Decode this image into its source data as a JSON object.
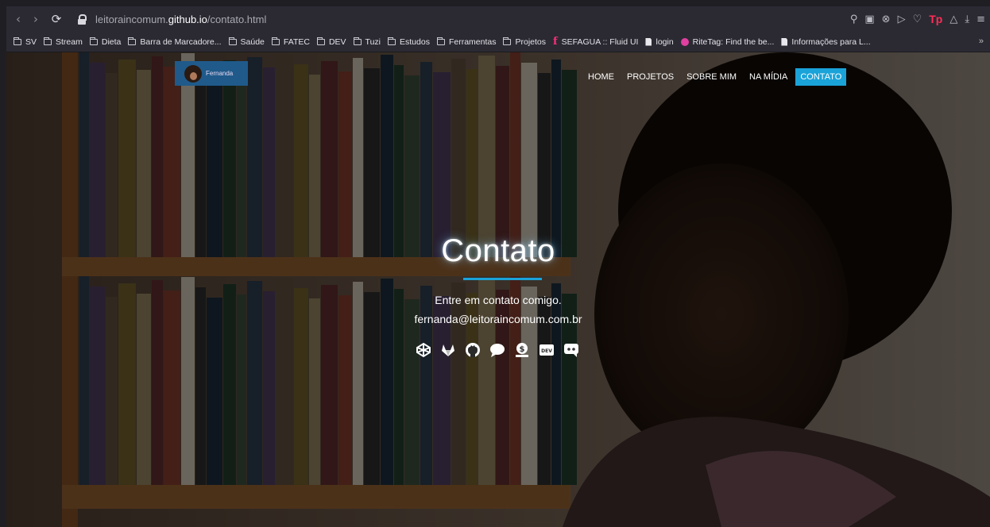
{
  "browser": {
    "url_prefix": "leitoraincomum.",
    "url_domain": "github.io",
    "url_path": "/contato.html",
    "profile_badge": "Tp"
  },
  "bookmarks": [
    {
      "label": "SV",
      "icon": "folder-icon"
    },
    {
      "label": "Stream",
      "icon": "folder-icon"
    },
    {
      "label": "Dieta",
      "icon": "folder-icon"
    },
    {
      "label": "Barra de Marcadore...",
      "icon": "folder-icon"
    },
    {
      "label": "Saúde",
      "icon": "folder-icon"
    },
    {
      "label": "FATEC",
      "icon": "folder-icon"
    },
    {
      "label": "DEV",
      "icon": "folder-icon"
    },
    {
      "label": "Tuzi",
      "icon": "folder-icon"
    },
    {
      "label": "Estudos",
      "icon": "folder-icon"
    },
    {
      "label": "Ferramentas",
      "icon": "folder-icon"
    },
    {
      "label": "Projetos",
      "icon": "folder-icon"
    },
    {
      "label": "SEFAGUA :: Fluid UI",
      "icon": "fluid-icon"
    },
    {
      "label": "login",
      "icon": "document-icon"
    },
    {
      "label": "RiteTag: Find the be...",
      "icon": "ritetag-icon"
    },
    {
      "label": "Informações para L...",
      "icon": "document-icon"
    }
  ],
  "bookmarks_more": "»",
  "site": {
    "logo_name": "Fernanda",
    "menu": [
      {
        "label": "HOME",
        "active": false
      },
      {
        "label": "PROJETOS",
        "active": false
      },
      {
        "label": "SOBRE MIM",
        "active": false
      },
      {
        "label": "NA MÍDIA",
        "active": false
      },
      {
        "label": "CONTATO",
        "active": true
      }
    ],
    "title": "Contato",
    "subtitle": "Entre em contato comigo.",
    "email": "fernanda@leitoraincomum.com.br",
    "dev_badge": "DEV",
    "socials": [
      "codepen-icon",
      "gitlab-icon",
      "github-icon",
      "chat-icon",
      "dollar-coin-icon",
      "dev-icon",
      "discord-icon"
    ]
  },
  "colors": {
    "accent": "#1aa3d9",
    "browser_chrome": "#2b2a33",
    "logo_bg": "#1f5a8a"
  }
}
